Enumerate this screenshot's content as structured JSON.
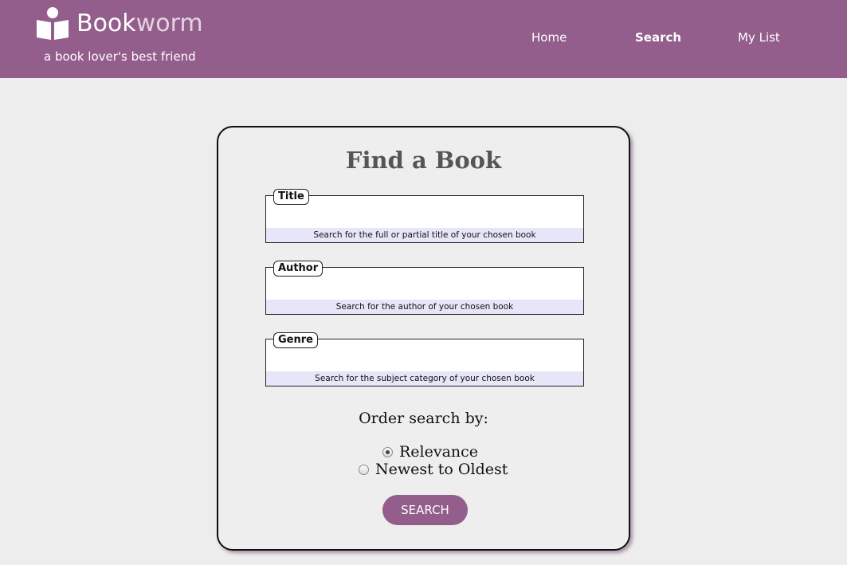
{
  "header": {
    "brand_bold": "Book",
    "brand_light": "worm",
    "tagline": "a book lover's best friend",
    "icon": "book-reader-icon",
    "nav": {
      "home": "Home",
      "search": "Search",
      "mylist": "My List"
    },
    "colors": {
      "accent": "#935d8c",
      "page_bg": "#ededed",
      "hint_bg": "#e6e6f8"
    }
  },
  "form": {
    "title": "Find a Book",
    "fields": [
      {
        "legend": "Title",
        "value": "",
        "hint": "Search for the full or partial title of your chosen book"
      },
      {
        "legend": "Author",
        "value": "",
        "hint": "Search for the author of your chosen book"
      },
      {
        "legend": "Genre",
        "value": "",
        "hint": "Search for the subject category of your chosen book"
      }
    ],
    "order_label": "Order search by:",
    "order_options": [
      {
        "label": "Relevance",
        "selected": true
      },
      {
        "label": "Newest to Oldest",
        "selected": false
      }
    ],
    "submit_label": "SEARCH"
  }
}
